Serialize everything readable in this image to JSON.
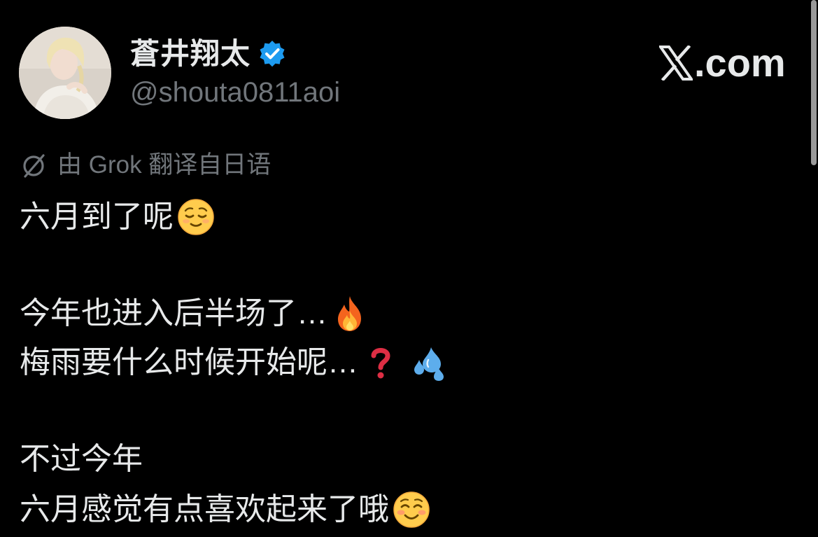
{
  "profile": {
    "display_name": "蒼井翔太",
    "handle": "@shouta0811aoi",
    "verified_icon": "verified-badge-icon",
    "verified_color": "#1d9bf0"
  },
  "site": {
    "logo_icon": "x-logo-icon",
    "domain_suffix": ".com"
  },
  "translation_notice": {
    "icon": "grok-icon",
    "text": "由 Grok 翻译自日语"
  },
  "tweet": {
    "lines": [
      {
        "text": "六月到了呢",
        "emoji": "relieved-face-emoji"
      },
      {
        "text": "今年也进入后半场了…",
        "emoji": "fire-emoji"
      },
      {
        "text": "梅雨要什么时候开始呢…",
        "emoji": "question-mark-emoji",
        "emoji2": "sweat-droplets-emoji"
      },
      {
        "text": "不过今年"
      },
      {
        "text": "六月感觉有点喜欢起来了哦",
        "emoji": "smiling-face-emoji"
      }
    ]
  },
  "colors": {
    "background": "#000000",
    "primary_text": "#e7e9ea",
    "secondary_text": "#71767b",
    "accent": "#1d9bf0"
  }
}
